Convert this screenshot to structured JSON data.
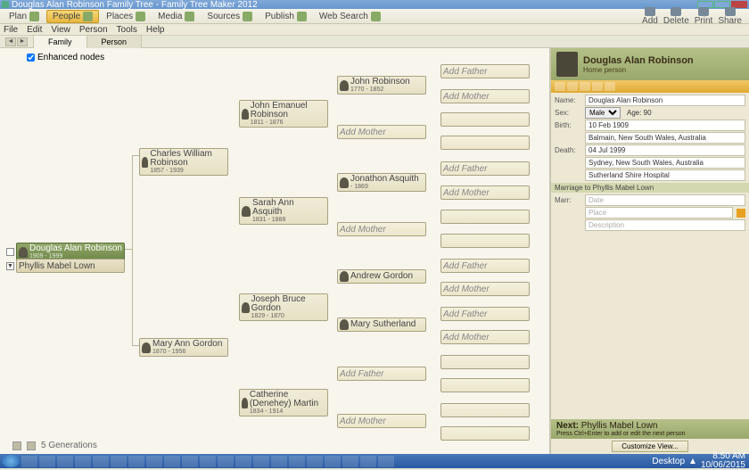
{
  "window": {
    "title": "Douglas Alan Robinson Family Tree - Family Tree Maker 2012"
  },
  "toolbar": {
    "plan": "Plan",
    "people": "People",
    "places": "Places",
    "media": "Media",
    "sources": "Sources",
    "publish": "Publish",
    "websearch": "Web Search",
    "right": {
      "add": "Add",
      "delete": "Delete",
      "print": "Print",
      "share": "Share"
    }
  },
  "menu": [
    "File",
    "Edit",
    "View",
    "Person",
    "Tools",
    "Help"
  ],
  "tabs": {
    "family": "Family",
    "person": "Person"
  },
  "enhanced_label": "Enhanced nodes",
  "generations": "5 Generations",
  "tree": {
    "focus": {
      "name": "Douglas Alan Robinson",
      "dates": "1909 - 1999"
    },
    "spouse": {
      "name": "Phyllis Mabel Lown"
    },
    "father": {
      "name": "Charles William Robinson",
      "dates": "1857 - 1939"
    },
    "mother": {
      "name": "Mary Ann Gordon",
      "dates": "1870 - 1956"
    },
    "pgf": {
      "name": "John Emanuel Robinson",
      "dates": "1811 - 1876"
    },
    "pgm": {
      "name": "Sarah Ann Asquith",
      "dates": "1831 - 1888"
    },
    "mgf": {
      "name": "Joseph Bruce Gordon",
      "dates": "1829 - 1870"
    },
    "mgm": {
      "name": "Catherine (Denehey) Martin",
      "dates": "1834 - 1914"
    },
    "ggf1": {
      "name": "John Robinson",
      "dates": "1770 - 1852"
    },
    "ggf2": {
      "name": "Jonathon Asquith",
      "dates": "- 1869"
    },
    "ggf3": {
      "name": "Andrew Gordon",
      "dates": ""
    },
    "ggm3": {
      "name": "Mary Sutherland",
      "dates": ""
    },
    "add_father": "Add Father",
    "add_mother": "Add Mother"
  },
  "detail": {
    "name": "Douglas Alan Robinson",
    "role": "Home person",
    "labels": {
      "name": "Name:",
      "sex": "Sex:",
      "age": "Age: 90",
      "birth": "Birth:",
      "death": "Death:",
      "marr": "Marr:"
    },
    "fields": {
      "name": "Douglas Alan Robinson",
      "sex": "Male",
      "birth_date": "10 Feb 1909",
      "birth_place": "Balmain, New South Wales, Australia",
      "death_date": "04 Jul 1999",
      "death_place": "Sydney, New South Wales, Australia",
      "death_desc": "Sutherland Shire Hospital",
      "marriage_header": "Marriage to Phyllis Mabel Lown",
      "marr_date": "Date",
      "marr_place": "Place",
      "marr_desc": "Description"
    },
    "next_label": "Next:",
    "next_person": "Phyllis Mabel Lown",
    "next_hint": "Press Ctrl+Enter to add or edit the next person",
    "customize": "Customize View..."
  },
  "taskbar": {
    "desktop": "Desktop",
    "time": "8:50 AM",
    "date": "10/06/2015"
  }
}
